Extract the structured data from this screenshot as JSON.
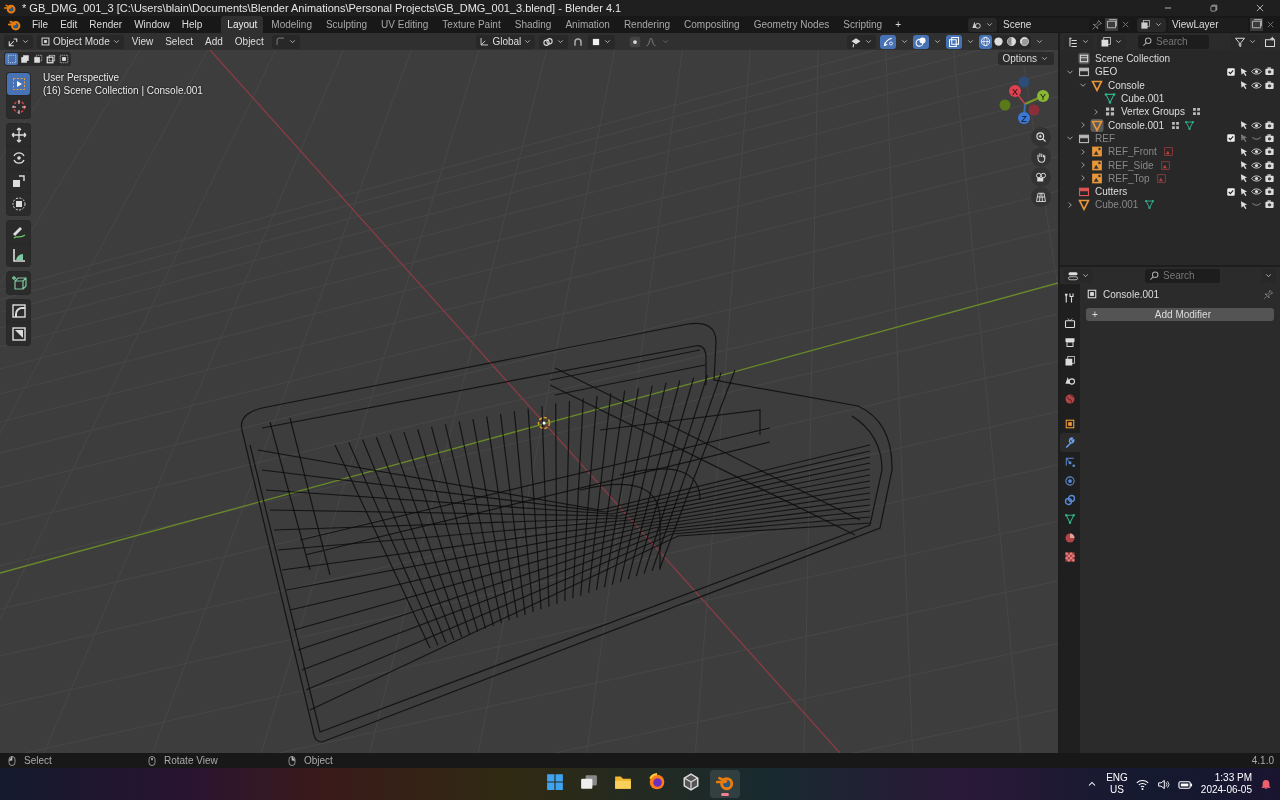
{
  "window": {
    "title": "* GB_DMG_001_3 [C:\\Users\\blain\\Documents\\Blender Animations\\Personal Projects\\GB_DMG_001_3.blend] - Blender 4.1"
  },
  "menu": [
    "File",
    "Edit",
    "Render",
    "Window",
    "Help"
  ],
  "workspaces": [
    {
      "label": "Layout",
      "selected": true
    },
    {
      "label": "Modeling",
      "selected": false
    },
    {
      "label": "Sculpting",
      "selected": false
    },
    {
      "label": "UV Editing",
      "selected": false
    },
    {
      "label": "Texture Paint",
      "selected": false
    },
    {
      "label": "Shading",
      "selected": false
    },
    {
      "label": "Animation",
      "selected": false
    },
    {
      "label": "Rendering",
      "selected": false
    },
    {
      "label": "Compositing",
      "selected": false
    },
    {
      "label": "Geometry Nodes",
      "selected": false
    },
    {
      "label": "Scripting",
      "selected": false
    }
  ],
  "add_workspace": "+",
  "scene": {
    "name": "Scene"
  },
  "view_layer": {
    "name": "ViewLayer"
  },
  "viewport_header": {
    "mode": "Object Mode",
    "menus": [
      "View",
      "Select",
      "Add",
      "Object"
    ],
    "orientation": "Global",
    "toggles": [
      {
        "kind": "gizmo",
        "on": true
      },
      {
        "kind": "overlay",
        "on": true
      },
      {
        "kind": "xray",
        "on": true
      }
    ],
    "shading": [
      {
        "kind": "wireframe",
        "selected": true
      },
      {
        "kind": "solid",
        "selected": false
      },
      {
        "kind": "material",
        "selected": false
      },
      {
        "kind": "rendered",
        "selected": false
      }
    ]
  },
  "viewport": {
    "select_modes": [
      {
        "kind": "set",
        "selected": true
      },
      {
        "kind": "extend",
        "selected": false
      },
      {
        "kind": "subtract",
        "selected": false
      },
      {
        "kind": "difference",
        "selected": false
      },
      {
        "kind": "intersect",
        "selected": false
      }
    ],
    "tool_groups": [
      [
        {
          "kind": "select_box",
          "selected": true
        },
        {
          "kind": "cursor",
          "selected": false
        }
      ],
      [
        {
          "kind": "move",
          "selected": false
        },
        {
          "kind": "rotate",
          "selected": false
        },
        {
          "kind": "scale",
          "selected": false
        },
        {
          "kind": "transform",
          "selected": false
        }
      ],
      [
        {
          "kind": "annotate",
          "selected": false
        },
        {
          "kind": "measure",
          "selected": false
        }
      ],
      [
        {
          "kind": "add_cube",
          "selected": false
        }
      ],
      [
        {
          "kind": "corner",
          "selected": false
        },
        {
          "kind": "square",
          "selected": false
        }
      ]
    ],
    "view_name": "User Perspective",
    "context": "(16) Scene Collection | Console.001",
    "options": "Options",
    "gizmo_axes": [
      "X",
      "Y",
      "Z"
    ]
  },
  "outliner": {
    "search": {
      "placeholder": "Search"
    },
    "tree": [
      {
        "name": "Scene Collection",
        "kind": "scene_collection",
        "disabled": false,
        "active": false,
        "children": [
          {
            "name": "GEO",
            "kind": "collection",
            "color": "#b8b8b8",
            "expanded": true,
            "checked": true,
            "visible": true,
            "disabled": false,
            "active": false,
            "children": [
              {
                "name": "Console",
                "kind": "object",
                "expanded": true,
                "visible": true,
                "disabled": false,
                "active": false,
                "children": [
                  {
                    "name": "Cube.001",
                    "kind": "mesh_data",
                    "disabled": false,
                    "active": false
                  },
                  {
                    "name": "Vertex Groups",
                    "kind": "vertex_groups",
                    "expanded": false,
                    "disabled": false,
                    "active": false,
                    "data_icons": [
                      {
                        "kind": "vertex_groups"
                      }
                    ]
                  }
                ]
              },
              {
                "name": "Console.001",
                "kind": "object",
                "expanded": false,
                "visible": true,
                "disabled": false,
                "active": true,
                "data_icons": [
                  {
                    "kind": "vertex_groups"
                  },
                  {
                    "kind": "mesh_data"
                  }
                ]
              }
            ]
          },
          {
            "name": "REF",
            "kind": "collection",
            "color": "#b8b8b8",
            "expanded": true,
            "checked": true,
            "visible": false,
            "disabled": true,
            "active": false,
            "children": [
              {
                "name": "REF_Front",
                "kind": "image_empty",
                "expanded": false,
                "visible": true,
                "disabled": true,
                "active": false,
                "data_icons": [
                  {
                    "kind": "image"
                  }
                ]
              },
              {
                "name": "REF_Side",
                "kind": "image_empty",
                "expanded": false,
                "visible": true,
                "disabled": true,
                "active": false,
                "data_icons": [
                  {
                    "kind": "image"
                  }
                ]
              },
              {
                "name": "REF_Top",
                "kind": "image_empty",
                "expanded": false,
                "visible": true,
                "disabled": true,
                "active": false,
                "data_icons": [
                  {
                    "kind": "image"
                  }
                ]
              }
            ]
          },
          {
            "name": "Cutters",
            "kind": "collection",
            "color": "#e05555",
            "checked": true,
            "visible": true,
            "disabled": false,
            "active": false
          },
          {
            "name": "Cube.001",
            "kind": "object",
            "expanded": false,
            "visible": false,
            "disabled": true,
            "active": false,
            "data_icons": [
              {
                "kind": "mesh_data"
              }
            ]
          }
        ]
      }
    ]
  },
  "properties": {
    "search": {
      "placeholder": "Search"
    },
    "tabs": [
      {
        "kind": "tool",
        "selected": false
      },
      {
        "kind": "render",
        "selected": false
      },
      {
        "kind": "output",
        "selected": false
      },
      {
        "kind": "view_layer",
        "selected": false
      },
      {
        "kind": "scene",
        "selected": false
      },
      {
        "kind": "world",
        "selected": false
      },
      {
        "kind": "object",
        "selected": false
      },
      {
        "kind": "modifiers",
        "selected": true
      },
      {
        "kind": "particles",
        "selected": false
      },
      {
        "kind": "physics",
        "selected": false
      },
      {
        "kind": "constraints",
        "selected": false
      },
      {
        "kind": "data",
        "selected": false
      },
      {
        "kind": "material",
        "selected": false
      },
      {
        "kind": "texture",
        "selected": false
      }
    ],
    "object_name": "Console.001",
    "add_modifier": "+",
    "add_modifier_label": "Add Modifier"
  },
  "status_bar": {
    "hints": [
      {
        "kind": "left_click",
        "label": "Select"
      },
      {
        "kind": "middle_click",
        "label": "Rotate View"
      },
      {
        "kind": "right_click",
        "label": "Object"
      }
    ],
    "version": "4.1.0"
  },
  "taskbar": {
    "apps": [
      {
        "kind": "start",
        "selected": false
      },
      {
        "kind": "task_view",
        "selected": false
      },
      {
        "kind": "file_explorer",
        "selected": false
      },
      {
        "kind": "firefox",
        "selected": false
      },
      {
        "kind": "cube_app",
        "selected": false
      },
      {
        "kind": "blender",
        "selected": true
      }
    ],
    "language": "ENG",
    "region": "US",
    "time": "1:33 PM",
    "date": "2024-06-05"
  }
}
